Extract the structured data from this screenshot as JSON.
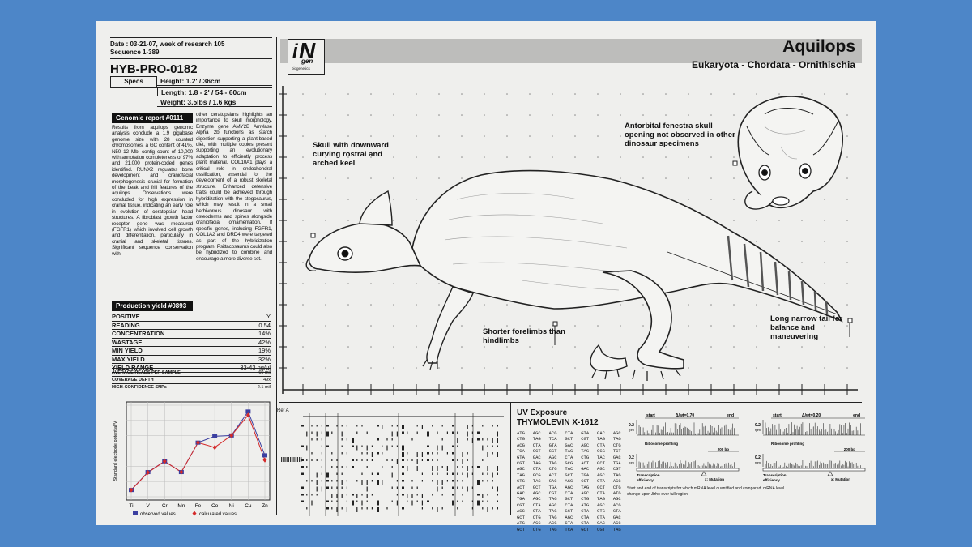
{
  "header": {
    "date_line": "Date : 03-21-07, week of research 105",
    "sequence_line": "Sequence 1-389",
    "code": "HYB-PRO-0182"
  },
  "specs": {
    "label": "Specs",
    "height": "Height: 1.2' / 36cm",
    "length": "Length: 1.8 - 2' / 54 - 60cm",
    "weight": "Weight: 3.5lbs / 1.6 kgs"
  },
  "genomic": {
    "title": "Genomic report #0111",
    "col1": "Results from aquilops genomic analysis conclude a 1.9 gigabase genome size with 28 counted chromosomes, a GC content of 41%, N50 12 Mb, contig count of 10,000 with annotation completeness of 97% and 21,000 protein-coded genes identified. RUNX2 regulates bone development and craniofacial morphogenesis crucial for formation of the beak and frill features of the aquilops. Observations were concluded for high expression in cranial tissue, indicating an early role in evolution of ceratopsian head structures. A fibroblast growth factor receptor gene was measured (FGFR1) which involved cell growth and differentiation, particularly in cranial and skeletal tissues. Significant sequence conservation with",
    "col2": "other ceratopsians highlights an importance to skull morphology. Enzyme gene AMY2B Amylase Alpha 2b functions as starch digestion supporting a plant-based diet, with multiple copies present supporting an evolutionary adaptation to efficiently process plant material. COL10A1 plays a critical role in endochondral ossification, essential for the development of a robust skeletal structure. Enhanced defensive traits could be achieved through hybridization with the stegosaurus, which may result in a small herbivorous dinosaur with osteoderms and spines alongside craniofacial ornamentation. If specific genes, including FGFR1, COL1A2 and DRD4 were targeted as part of the hybridization program, Psittacosaurus could also be hybridized to combine and encourage a more diverse set."
  },
  "production": {
    "title": "Production yield #0893",
    "rows": [
      {
        "k": "POSITIVE",
        "v": "Y"
      },
      {
        "k": "READING",
        "v": "0.54"
      },
      {
        "k": "CONCENTRATION",
        "v": "14%"
      },
      {
        "k": "WASTAGE",
        "v": "42%"
      },
      {
        "k": "MIN YIELD",
        "v": "19%"
      },
      {
        "k": "MAX YIELD",
        "v": "32%"
      },
      {
        "k": "YIELD RANGE",
        "v": "33-43 ng/µl"
      }
    ],
    "small_rows": [
      {
        "k": "AVERAGE READS PER SAMPLE",
        "v": "60 mil"
      },
      {
        "k": "COVERAGE DEPTH",
        "v": "49x"
      },
      {
        "k": "HIGH-CONFIDENCE SNPs",
        "v": "2.1 mil"
      }
    ]
  },
  "chart_data": {
    "type": "line",
    "categories": [
      "Ti",
      "V",
      "Cr",
      "Mn",
      "Fe",
      "Co",
      "Ni",
      "Cu",
      "Zn"
    ],
    "ylabel": "Standard electrode potential/V",
    "series": [
      {
        "name": "observed values",
        "values": [
          -1.63,
          -1.18,
          -0.91,
          -1.18,
          -0.44,
          -0.28,
          -0.26,
          0.34,
          -0.76
        ],
        "color": "#3b3fa0"
      },
      {
        "name": "calculated values",
        "values": [
          -1.63,
          -1.19,
          -0.91,
          -1.18,
          -0.44,
          -0.56,
          -0.26,
          0.25,
          -0.88
        ],
        "color": "#d42a2a"
      }
    ],
    "ylim": [
      -1.8,
      0.5
    ],
    "grid": true
  },
  "brand": {
    "logo_i": "i",
    "logo_n": "N",
    "logo_gen": "gen",
    "logo_sub": "biogenetics"
  },
  "species": {
    "name": "Aquilops",
    "taxonomy": "Eukaryota - Chordata - Ornithischia"
  },
  "annotations": {
    "skull": "Skull with downward curving rostral and arched keel",
    "antorbital": "Antorbital fenestra skull opening not observed in other dinosaur specimens",
    "forelimbs": "Shorter forelimbs than hindlimbs",
    "tail": "Long narrow tail for balance and maneuvering"
  },
  "refa": {
    "label": "Ref A"
  },
  "uv": {
    "title": "UV Exposure",
    "subtitle": "THYMOLEVIN X-1612",
    "codes": [
      "ATG AGC ACG CTA GTA GAC AGC",
      "CTG TAG TCA GCT CGT TAG TAG",
      "ACG CTA GTA GAC AGC CTA CTG",
      "TCA GCT CGT TAG TAG GCG TCT",
      "GTA GAC AGC CTA CTG TAC GAC",
      "CGT TAG TAG GCG ACT GCT TGA",
      "AGC CTA CTG TAC GAC AGC CGT",
      "TAG GCG ACT GCT TGA AGC TAG",
      "CTG TAC GAC AGC CGT CTA AGC",
      "ACT GCT TGA AGC TAG GCT CTG",
      "GAC AGC CGT CTA AGC CTA ATG",
      "TGA AGC TAG GCT CTG TAG AGC",
      "CGT CTA AGC CTA ATG AGC ACG",
      "AGC CTA TAG GCT CTA CTG CTA",
      "GCT CTG TAG AGC CTA GTA GAC",
      "ATG AGC ACG CTA GTA GAC AGC",
      "GCT CTG TAG TCA GCT CGT TAG"
    ]
  },
  "profiles": [
    {
      "start": "start",
      "end": "end",
      "ratio": "Δ/wt=0.70",
      "scale_top": "0.2",
      "scale_top_sub": "rpm",
      "ribo": "Ribosome profiling",
      "bp": "200 bp",
      "scale_mid": "0.2",
      "scale_mid_sub": "rpm",
      "tx": "Transcription",
      "eff": "efficiency",
      "mutation": "x: Mutation"
    },
    {
      "start": "start",
      "end": "end",
      "ratio": "Δ/wt=0.20",
      "scale_top": "0.2",
      "scale_top_sub": "rpm",
      "ribo": "Ribosome profiling",
      "bp": "200 bp",
      "scale_mid": "0.2",
      "scale_mid_sub": "rpm",
      "tx": "Transcription",
      "eff": "efficiency",
      "mutation": "x: Mutation"
    }
  ],
  "profile_note": "Start and end of transcripts for which mRNA level quantified and compared. mRNA level change upon Δrho over full region."
}
